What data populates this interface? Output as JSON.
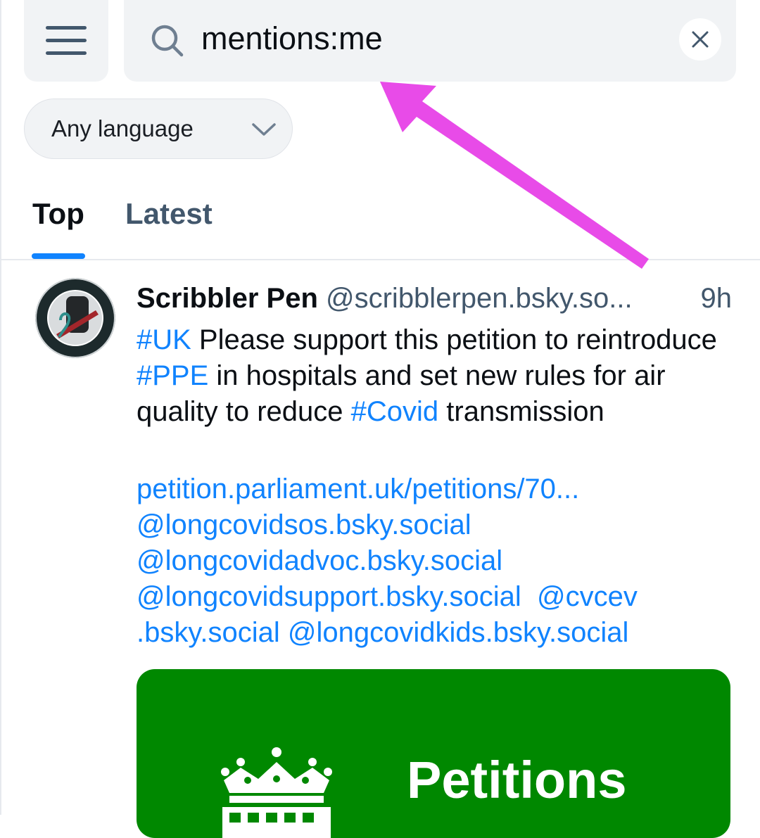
{
  "search": {
    "query": "mentions:me"
  },
  "filters": {
    "language": "Any language"
  },
  "tabs": [
    {
      "label": "Top",
      "active": true
    },
    {
      "label": "Latest",
      "active": false
    }
  ],
  "post": {
    "author_name": "Scribbler Pen",
    "author_handle": "@scribblerpen.bsky.so...",
    "time": "9h",
    "body": {
      "tag_uk": "#UK",
      "text1": " Please support this petition to reintroduce ",
      "tag_ppe": "#PPE",
      "text2": " in hospitals and set new rules for air quality to reduce ",
      "tag_covid": "#Covid",
      "text3": " transmission"
    },
    "links": {
      "petition_url": "petition.parliament.uk/petitions/70...",
      "mention1": "@longcovidsos.bsky.social",
      "mention2": "@longcovidadvoc.bsky.social",
      "mention3": "@longcovidsupport.bsky.social",
      "mention4": "@cvcev",
      "mention4_cont": ".bsky.social",
      "mention5": "@longcovidkids.bsky.social"
    },
    "embed": {
      "title": "Petitions",
      "background": "#008800"
    }
  },
  "colors": {
    "accent": "#1083fe",
    "annotation_arrow": "#e84be8",
    "muted_text": "#42576c"
  },
  "icons": [
    "menu-icon",
    "search-icon",
    "close-icon",
    "chevron-down-icon",
    "portcullis-logo",
    "avatar-image"
  ]
}
